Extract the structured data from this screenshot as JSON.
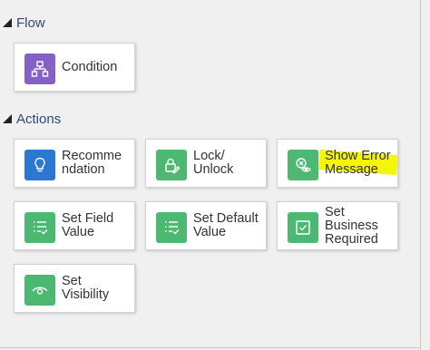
{
  "sections": {
    "flow": {
      "title": "Flow",
      "items": [
        {
          "lines": [
            "Condition"
          ],
          "icon": "condition-flowchart-icon",
          "color": "#8661c5"
        }
      ]
    },
    "actions": {
      "title": "Actions",
      "items": [
        {
          "lines": [
            "Recomme",
            "ndation"
          ],
          "icon": "lightbulb-icon",
          "color": "#2b78d2"
        },
        {
          "lines": [
            "Lock/",
            "Unlock"
          ],
          "icon": "lock-edit-icon",
          "color": "#4cb872"
        },
        {
          "lines": [
            "Show Error",
            "Message"
          ],
          "icon": "show-error-icon",
          "color": "#4cb872"
        },
        {
          "lines": [
            "Set Field",
            "Value"
          ],
          "icon": "list-check-icon",
          "color": "#4cb872"
        },
        {
          "lines": [
            "Set Default",
            "Value"
          ],
          "icon": "list-check-icon",
          "color": "#4cb872"
        },
        {
          "lines": [
            "Set",
            "Business",
            "Required"
          ],
          "icon": "checkbox-icon",
          "color": "#4cb872"
        },
        {
          "lines": [
            "Set",
            "Visibility"
          ],
          "icon": "eye-icon",
          "color": "#4cb872"
        }
      ]
    }
  },
  "highlight_color": "#f5f50a"
}
